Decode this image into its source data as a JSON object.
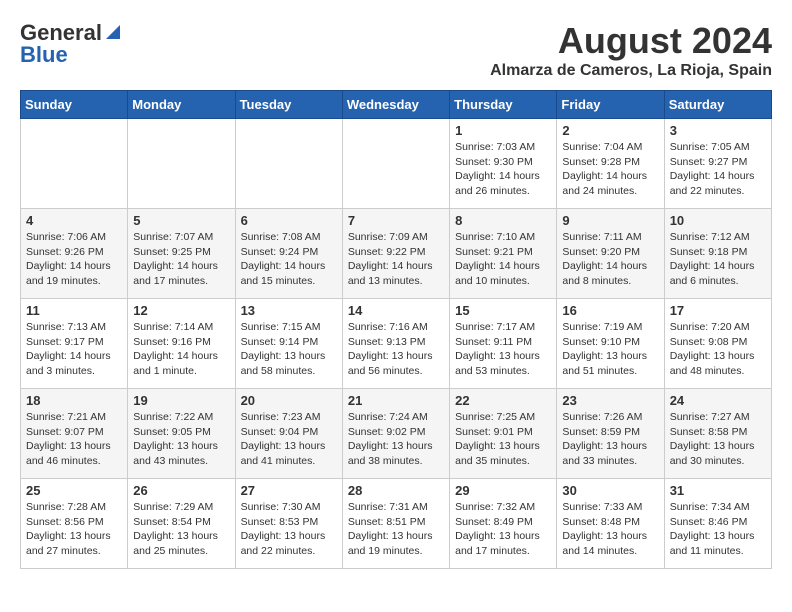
{
  "header": {
    "logo_line1": "General",
    "logo_line2": "Blue",
    "title": "August 2024",
    "subtitle": "Almarza de Cameros, La Rioja, Spain"
  },
  "days_of_week": [
    "Sunday",
    "Monday",
    "Tuesday",
    "Wednesday",
    "Thursday",
    "Friday",
    "Saturday"
  ],
  "weeks": [
    [
      {
        "day": "",
        "content": ""
      },
      {
        "day": "",
        "content": ""
      },
      {
        "day": "",
        "content": ""
      },
      {
        "day": "",
        "content": ""
      },
      {
        "day": "1",
        "content": "Sunrise: 7:03 AM\nSunset: 9:30 PM\nDaylight: 14 hours and 26 minutes."
      },
      {
        "day": "2",
        "content": "Sunrise: 7:04 AM\nSunset: 9:28 PM\nDaylight: 14 hours and 24 minutes."
      },
      {
        "day": "3",
        "content": "Sunrise: 7:05 AM\nSunset: 9:27 PM\nDaylight: 14 hours and 22 minutes."
      }
    ],
    [
      {
        "day": "4",
        "content": "Sunrise: 7:06 AM\nSunset: 9:26 PM\nDaylight: 14 hours and 19 minutes."
      },
      {
        "day": "5",
        "content": "Sunrise: 7:07 AM\nSunset: 9:25 PM\nDaylight: 14 hours and 17 minutes."
      },
      {
        "day": "6",
        "content": "Sunrise: 7:08 AM\nSunset: 9:24 PM\nDaylight: 14 hours and 15 minutes."
      },
      {
        "day": "7",
        "content": "Sunrise: 7:09 AM\nSunset: 9:22 PM\nDaylight: 14 hours and 13 minutes."
      },
      {
        "day": "8",
        "content": "Sunrise: 7:10 AM\nSunset: 9:21 PM\nDaylight: 14 hours and 10 minutes."
      },
      {
        "day": "9",
        "content": "Sunrise: 7:11 AM\nSunset: 9:20 PM\nDaylight: 14 hours and 8 minutes."
      },
      {
        "day": "10",
        "content": "Sunrise: 7:12 AM\nSunset: 9:18 PM\nDaylight: 14 hours and 6 minutes."
      }
    ],
    [
      {
        "day": "11",
        "content": "Sunrise: 7:13 AM\nSunset: 9:17 PM\nDaylight: 14 hours and 3 minutes."
      },
      {
        "day": "12",
        "content": "Sunrise: 7:14 AM\nSunset: 9:16 PM\nDaylight: 14 hours and 1 minute."
      },
      {
        "day": "13",
        "content": "Sunrise: 7:15 AM\nSunset: 9:14 PM\nDaylight: 13 hours and 58 minutes."
      },
      {
        "day": "14",
        "content": "Sunrise: 7:16 AM\nSunset: 9:13 PM\nDaylight: 13 hours and 56 minutes."
      },
      {
        "day": "15",
        "content": "Sunrise: 7:17 AM\nSunset: 9:11 PM\nDaylight: 13 hours and 53 minutes."
      },
      {
        "day": "16",
        "content": "Sunrise: 7:19 AM\nSunset: 9:10 PM\nDaylight: 13 hours and 51 minutes."
      },
      {
        "day": "17",
        "content": "Sunrise: 7:20 AM\nSunset: 9:08 PM\nDaylight: 13 hours and 48 minutes."
      }
    ],
    [
      {
        "day": "18",
        "content": "Sunrise: 7:21 AM\nSunset: 9:07 PM\nDaylight: 13 hours and 46 minutes."
      },
      {
        "day": "19",
        "content": "Sunrise: 7:22 AM\nSunset: 9:05 PM\nDaylight: 13 hours and 43 minutes."
      },
      {
        "day": "20",
        "content": "Sunrise: 7:23 AM\nSunset: 9:04 PM\nDaylight: 13 hours and 41 minutes."
      },
      {
        "day": "21",
        "content": "Sunrise: 7:24 AM\nSunset: 9:02 PM\nDaylight: 13 hours and 38 minutes."
      },
      {
        "day": "22",
        "content": "Sunrise: 7:25 AM\nSunset: 9:01 PM\nDaylight: 13 hours and 35 minutes."
      },
      {
        "day": "23",
        "content": "Sunrise: 7:26 AM\nSunset: 8:59 PM\nDaylight: 13 hours and 33 minutes."
      },
      {
        "day": "24",
        "content": "Sunrise: 7:27 AM\nSunset: 8:58 PM\nDaylight: 13 hours and 30 minutes."
      }
    ],
    [
      {
        "day": "25",
        "content": "Sunrise: 7:28 AM\nSunset: 8:56 PM\nDaylight: 13 hours and 27 minutes."
      },
      {
        "day": "26",
        "content": "Sunrise: 7:29 AM\nSunset: 8:54 PM\nDaylight: 13 hours and 25 minutes."
      },
      {
        "day": "27",
        "content": "Sunrise: 7:30 AM\nSunset: 8:53 PM\nDaylight: 13 hours and 22 minutes."
      },
      {
        "day": "28",
        "content": "Sunrise: 7:31 AM\nSunset: 8:51 PM\nDaylight: 13 hours and 19 minutes."
      },
      {
        "day": "29",
        "content": "Sunrise: 7:32 AM\nSunset: 8:49 PM\nDaylight: 13 hours and 17 minutes."
      },
      {
        "day": "30",
        "content": "Sunrise: 7:33 AM\nSunset: 8:48 PM\nDaylight: 13 hours and 14 minutes."
      },
      {
        "day": "31",
        "content": "Sunrise: 7:34 AM\nSunset: 8:46 PM\nDaylight: 13 hours and 11 minutes."
      }
    ]
  ]
}
